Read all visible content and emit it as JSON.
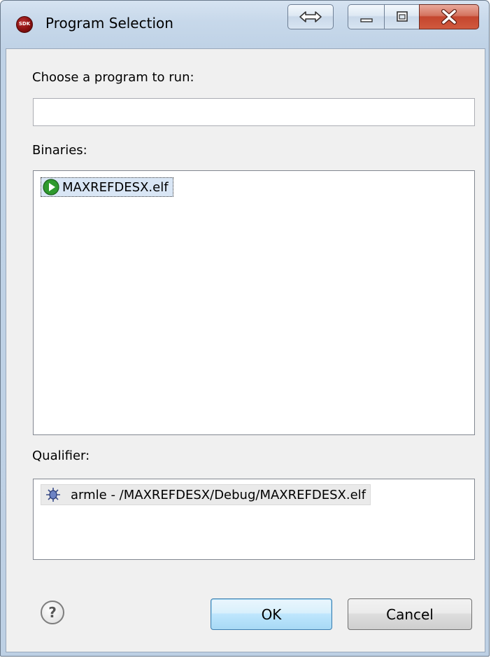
{
  "window": {
    "title": "Program Selection",
    "app_icon": "sdk-icon",
    "controls": [
      "resize-icon",
      "minimize-icon",
      "maximize-icon",
      "close-icon"
    ]
  },
  "form": {
    "program_label": "Choose a program to run:",
    "program_value": "",
    "binaries_label": "Binaries:",
    "binaries": [
      {
        "label": "MAXREFDESX.elf",
        "icon": "run-binary-icon",
        "selected": true
      }
    ],
    "qualifier_label": "Qualifier:",
    "qualifiers": [
      {
        "label": "armle - /MAXREFDESX/Debug/MAXREFDESX.elf",
        "icon": "bug-icon"
      }
    ]
  },
  "footer": {
    "help_icon": "help-icon",
    "ok_label": "OK",
    "cancel_label": "Cancel"
  },
  "colors": {
    "close_button": "#c4452e",
    "ok_border": "#3c7fb1",
    "selection_bg": "#d9e6f5"
  }
}
